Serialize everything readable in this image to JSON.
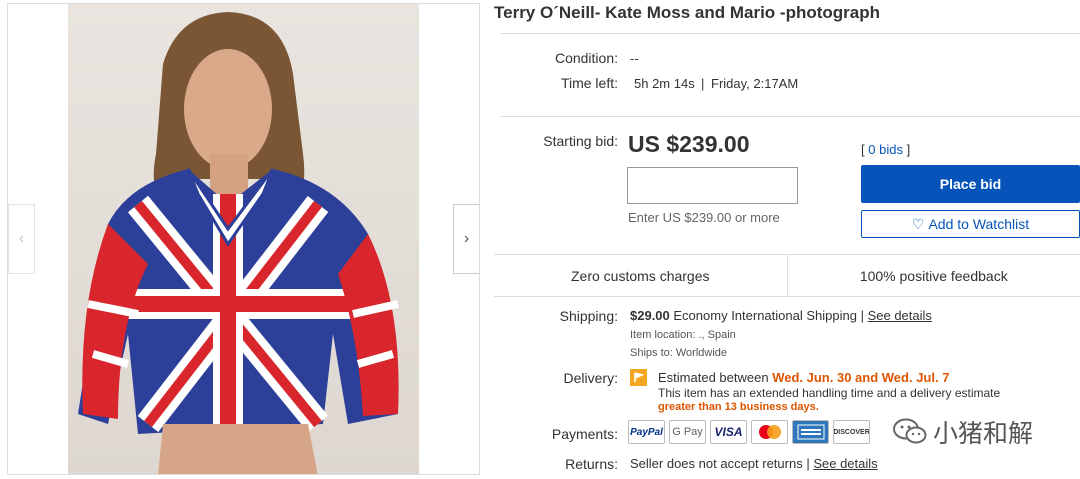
{
  "listing": {
    "title": "Terry O´Neill- Kate Moss and Mario -photograph"
  },
  "gallery": {
    "prev_icon": "chevron-left-icon",
    "next_icon": "chevron-right-icon"
  },
  "info": {
    "condition_label": "Condition:",
    "condition_value": "--",
    "time_left_label": "Time left:",
    "time_left_value": "5h 2m 14s",
    "time_left_separator": "|",
    "end_time": "Friday, 2:17AM"
  },
  "bidding": {
    "starting_bid_label": "Starting bid:",
    "price": "US $239.00",
    "bid_input_value": "",
    "bid_help": "Enter US $239.00 or more",
    "bids_open": "[",
    "bids_count": "0 bids",
    "bids_close": "]",
    "place_bid_label": "Place bid",
    "watchlist_label": "Add to Watchlist",
    "watchlist_icon": "heart-icon"
  },
  "trust": {
    "customs": "Zero customs charges",
    "feedback": "100% positive feedback"
  },
  "shipping": {
    "label": "Shipping:",
    "cost": "$29.00",
    "method": "Economy International Shipping |",
    "details_link": "See details",
    "location_label": "Item location:",
    "location_value": "., Spain",
    "ships_to_label": "Ships to:",
    "ships_to_value": "Worldwide"
  },
  "delivery": {
    "label": "Delivery:",
    "icon": "flag-icon",
    "estimated_prefix": "Estimated between",
    "estimated_dates": "Wed. Jun. 30 and Wed. Jul. 7",
    "note": "This item has an extended handling time and a delivery estimate",
    "note_emphasis": "greater than 13 business days."
  },
  "payments": {
    "label": "Payments:",
    "methods": [
      "PayPal",
      "G Pay",
      "VISA",
      "MasterCard",
      "AMERICAN EXPRESS",
      "DISCOVER"
    ]
  },
  "returns": {
    "label": "Returns:",
    "text": "Seller does not accept returns |",
    "details_link": "See details"
  },
  "watermark": {
    "text": "小猪和解",
    "icon": "wechat-icon"
  },
  "colors": {
    "primary_blue": "#0654ba",
    "accent_orange": "#dd5500",
    "flag_orange": "#f5a623"
  }
}
